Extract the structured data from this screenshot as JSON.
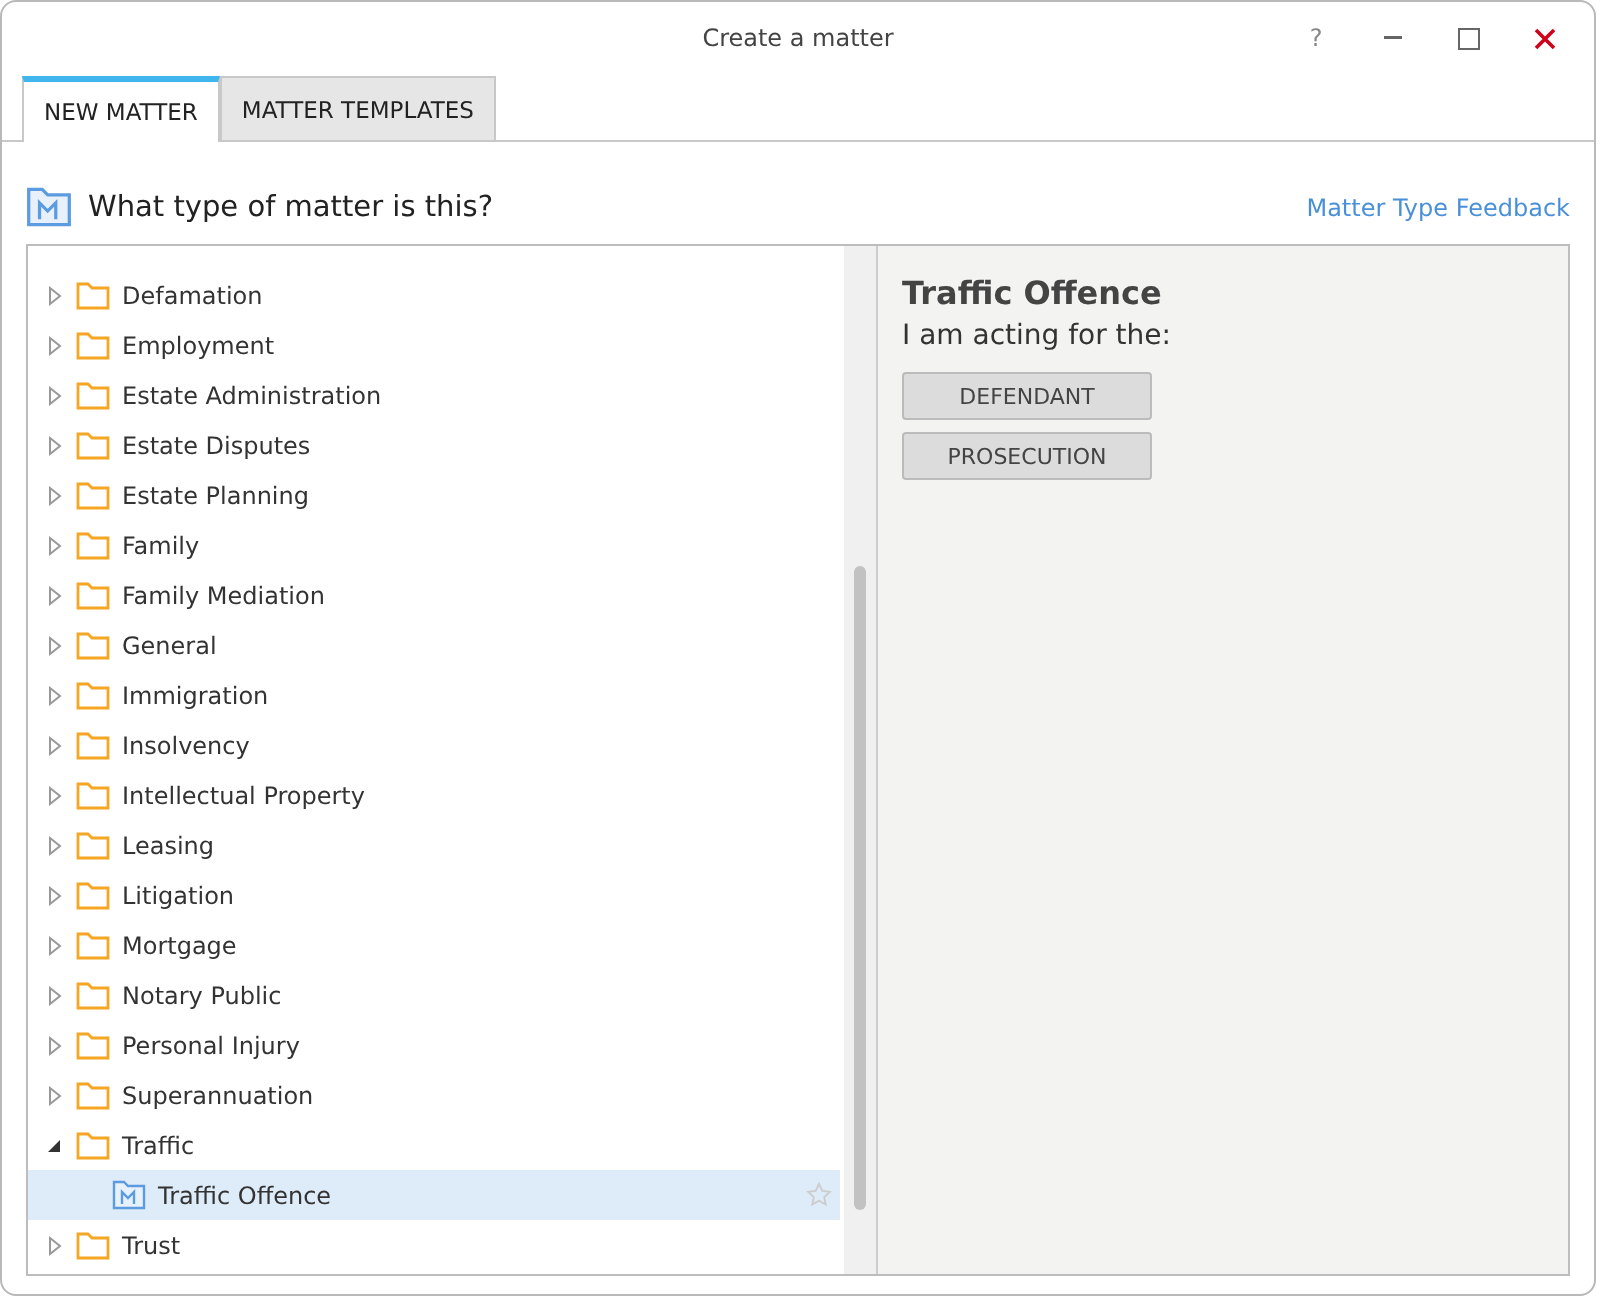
{
  "window": {
    "title": "Create a matter",
    "help": "?"
  },
  "tabs": [
    {
      "label": "NEW MATTER",
      "selected": true
    },
    {
      "label": "MATTER TEMPLATES",
      "selected": false
    }
  ],
  "question": "What type of matter is this?",
  "feedback_link": "Matter Type Feedback",
  "tree": [
    {
      "label": "Defamation",
      "expanded": false
    },
    {
      "label": "Employment",
      "expanded": false
    },
    {
      "label": "Estate Administration",
      "expanded": false
    },
    {
      "label": "Estate Disputes",
      "expanded": false
    },
    {
      "label": "Estate Planning",
      "expanded": false
    },
    {
      "label": "Family",
      "expanded": false
    },
    {
      "label": "Family Mediation",
      "expanded": false
    },
    {
      "label": "General",
      "expanded": false
    },
    {
      "label": "Immigration",
      "expanded": false
    },
    {
      "label": "Insolvency",
      "expanded": false
    },
    {
      "label": "Intellectual Property",
      "expanded": false
    },
    {
      "label": "Leasing",
      "expanded": false
    },
    {
      "label": "Litigation",
      "expanded": false
    },
    {
      "label": "Mortgage",
      "expanded": false
    },
    {
      "label": "Notary Public",
      "expanded": false
    },
    {
      "label": "Personal Injury",
      "expanded": false
    },
    {
      "label": "Superannuation",
      "expanded": false
    },
    {
      "label": "Traffic",
      "expanded": true,
      "children": [
        {
          "label": "Traffic Offence",
          "selected": true
        }
      ]
    },
    {
      "label": "Trust",
      "expanded": false
    }
  ],
  "detail": {
    "title": "Traffic Offence",
    "prompt": "I am acting for the:",
    "buttons": [
      "DEFENDANT",
      "PROSECUTION"
    ]
  }
}
